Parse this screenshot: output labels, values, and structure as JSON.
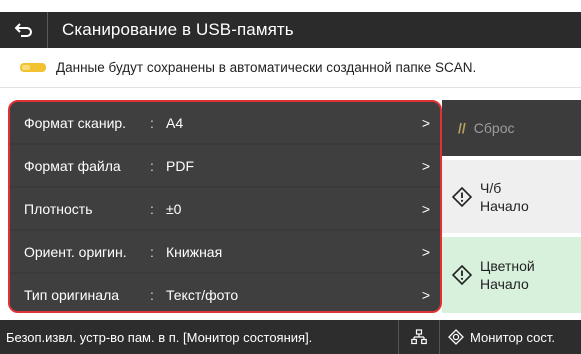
{
  "header": {
    "title": "Сканирование в USB-память",
    "back_icon": "back-arrow-icon"
  },
  "notice": {
    "text": "Данные будут сохранены в автоматически созданной папке SCAN.",
    "icon": "usb-memory-icon",
    "icon_color": "#f2c230"
  },
  "settings": {
    "separator": ":",
    "arrow": ">",
    "items": [
      {
        "label": "Формат сканир.",
        "value": "A4"
      },
      {
        "label": "Формат файла",
        "value": "PDF"
      },
      {
        "label": "Плотность",
        "value": "±0"
      },
      {
        "label": "Ориент. оригин.",
        "value": "Книжная"
      },
      {
        "label": "Тип оригинала",
        "value": "Текст/фото"
      }
    ]
  },
  "actions": {
    "reset_label": "Сброс",
    "bw_start_label": "Ч/б\nНачало",
    "color_start_label": "Цветной\nНачало"
  },
  "status": {
    "message": "Безоп.извл. устр-во пам. в п. [Монитор состояния].",
    "monitor_label": "Монитор сост."
  },
  "colors": {
    "highlight_border": "#e03232",
    "color_start_bg": "#d8f1dd",
    "bw_start_bg": "#efefef"
  }
}
